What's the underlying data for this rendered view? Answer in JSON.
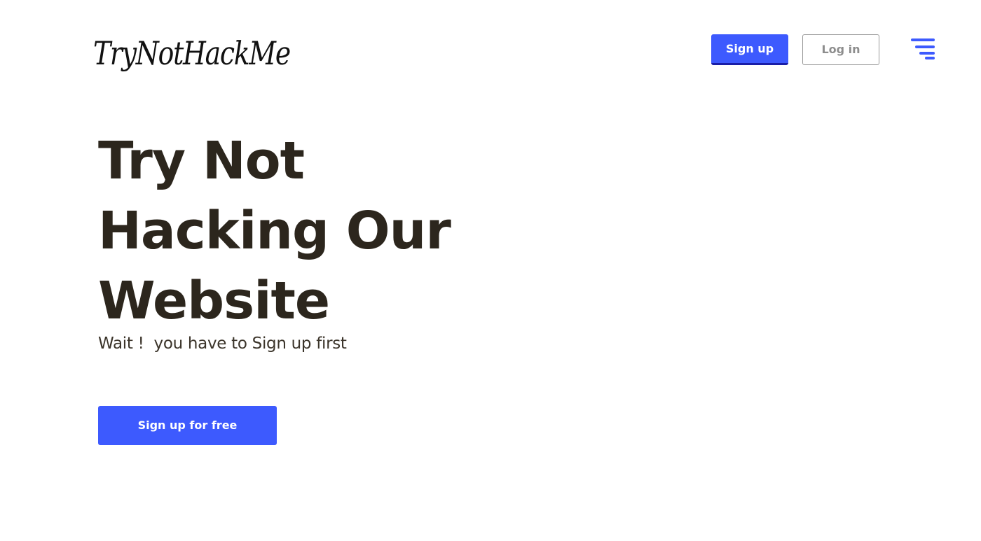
{
  "header": {
    "logo_text": "TryNotHackMe",
    "signup_label": "Sign up",
    "login_label": "Log in",
    "menu_icon": "hamburger-menu-icon"
  },
  "hero": {
    "title_lines": [
      "Try Not",
      "Hacking Our",
      "Website"
    ],
    "subtitle": "Wait !  you have to Sign up first",
    "cta_label": "Sign up for free"
  },
  "colors": {
    "accent": "#3d5afe",
    "accent_dark": "#1a1ea8",
    "heading": "#2c261d",
    "muted_button_text": "#8d8d8d"
  }
}
